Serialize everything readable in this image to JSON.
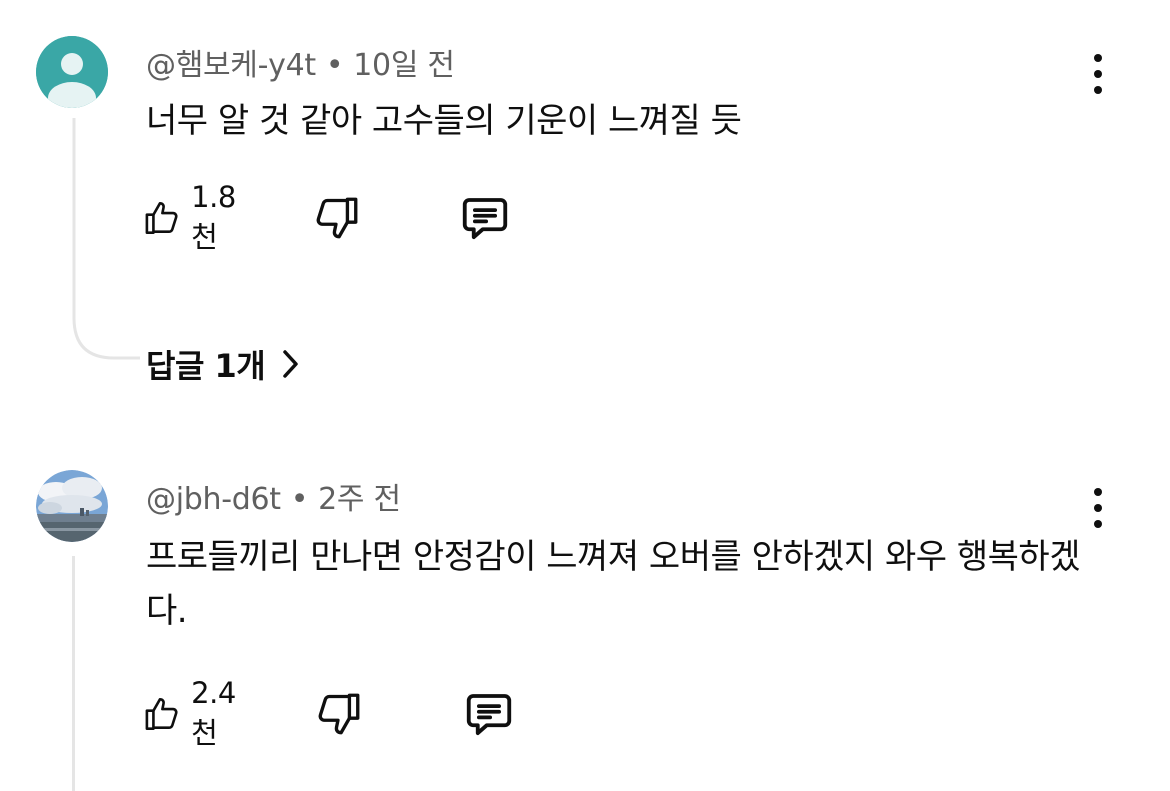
{
  "comments": [
    {
      "author": "@햄보케-y4t",
      "separator": "•",
      "time": "10일 전",
      "text": "너무 알 것 같아 고수들의 기운이 느껴질 듯",
      "likes": "1.8천",
      "replies_label": "답글 1개",
      "avatar_color": "#3fa9a9"
    },
    {
      "author": "@jbh-d6t",
      "separator": "•",
      "time": "2주 전",
      "text": "프로들끼리 만나면 안정감이 느껴져 오버를 안하겠지 와우 행복하겠다.",
      "likes": "2.4천"
    }
  ]
}
